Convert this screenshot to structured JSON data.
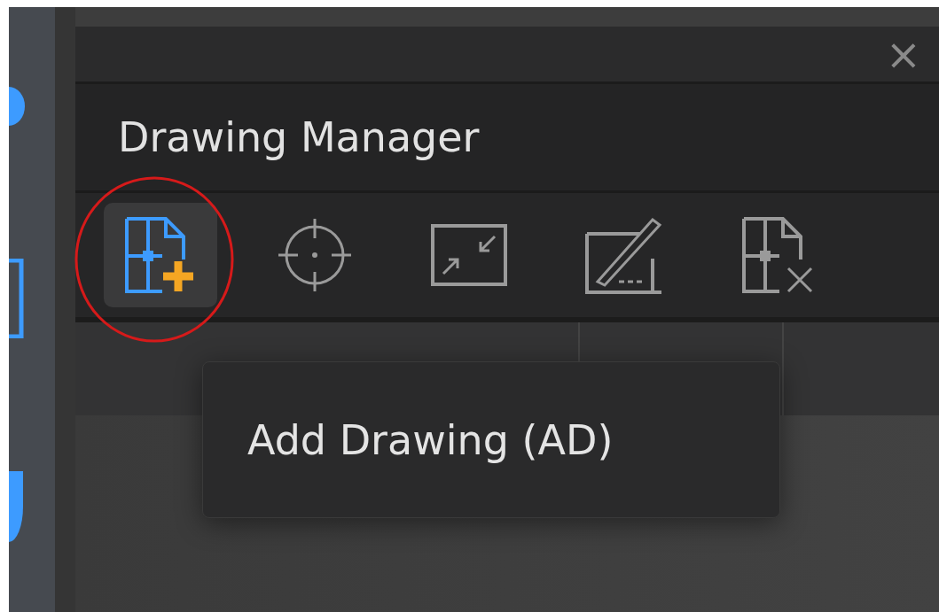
{
  "window": {
    "close": "×"
  },
  "panel": {
    "title": "Drawing Manager"
  },
  "toolbar": [
    {
      "kind": "add",
      "selected": true
    },
    {
      "kind": "locate",
      "selected": false
    },
    {
      "kind": "shrink",
      "selected": false
    },
    {
      "kind": "edit",
      "selected": false
    },
    {
      "kind": "remove",
      "selected": false
    }
  ],
  "tooltip": {
    "text": "Add Drawing (AD)"
  },
  "annotation": {
    "kind": "circle"
  }
}
